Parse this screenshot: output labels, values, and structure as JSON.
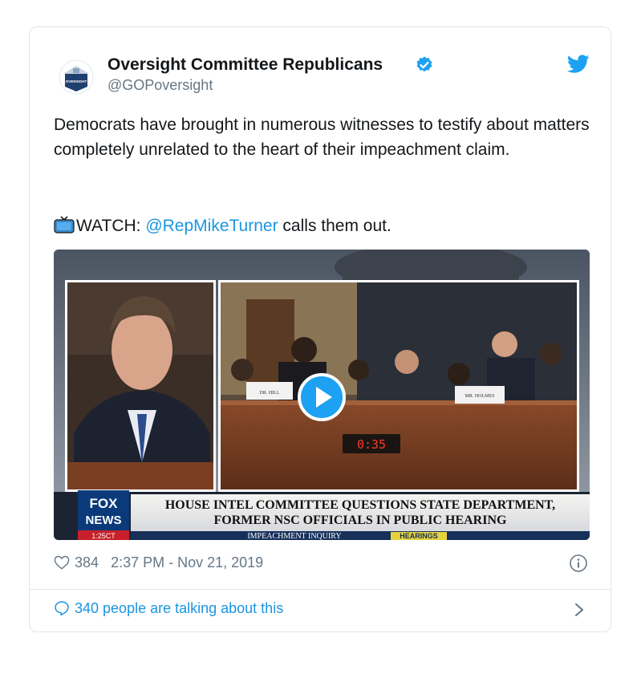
{
  "tweet": {
    "author_name": "Oversight Committee Republicans",
    "handle": "@GOPoversight",
    "avatar_text": "OVERSIGHT",
    "verified_icon": "verified-badge-icon",
    "twitter_icon": "twitter-bird-icon",
    "body": "Democrats have brought in numerous witnesses to testify about matters completely unrelated to the heart of their impeachment claim.",
    "watch_prefix": "WATCH: ",
    "mention": "@RepMikeTurner",
    "watch_suffix": " calls them out."
  },
  "video": {
    "nameplate_left": "DR. HILL",
    "nameplate_right": "MR. HOLMES",
    "timer": "0:35",
    "chyron_line1": "HOUSE INTEL COMMITTEE QUESTIONS STATE DEPARTMENT,",
    "chyron_line2": "FORMER NSC OFFICIALS IN PUBLIC HEARING",
    "ticker_left": "IMPEACHMENT INQUIRY",
    "ticker_right": "HEARINGS",
    "network_line1": "FOX",
    "network_line2": "NEWS",
    "clock": "1:25CT",
    "play_icon": "play-icon"
  },
  "footer": {
    "likes": "384",
    "timestamp": "2:37 PM - Nov 21, 2019",
    "talking": "340 people are talking about this"
  },
  "colors": {
    "accent": "#1b95e0",
    "verified": "#1da1f2",
    "text": "#14171a",
    "muted": "#657786"
  }
}
